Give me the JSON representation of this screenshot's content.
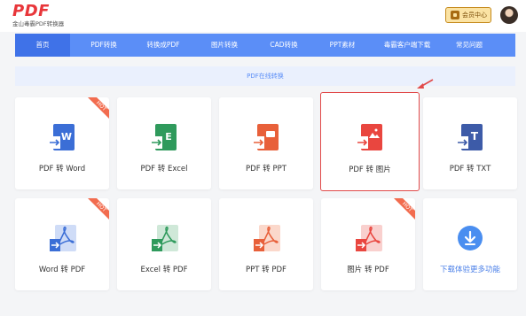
{
  "header": {
    "logo_text": "PDF",
    "logo_subtitle": "金山毒霸PDF转换器",
    "member_label": "会员中心"
  },
  "nav": {
    "items": [
      {
        "label": "首页",
        "active": true
      },
      {
        "label": "PDF转换",
        "active": false
      },
      {
        "label": "转换成PDF",
        "active": false
      },
      {
        "label": "图片转换",
        "active": false
      },
      {
        "label": "CAD转换",
        "active": false
      },
      {
        "label": "PPT素材",
        "active": false
      },
      {
        "label": "毒霸客户端下载",
        "active": false
      },
      {
        "label": "常见问题",
        "active": false
      }
    ]
  },
  "subbar": {
    "title": "PDF在线转换"
  },
  "tools": {
    "row1": [
      {
        "label": "PDF 转 Word",
        "badge": "HOT",
        "color": "#3b6ed6",
        "letter": "W"
      },
      {
        "label": "PDF 转 Excel",
        "badge": "",
        "color": "#2f9a5c",
        "letter": "E"
      },
      {
        "label": "PDF 转 PPT",
        "badge": "",
        "color": "#e8603a",
        "letter": "P"
      },
      {
        "label": "PDF 转 图片",
        "badge": "",
        "color": "#e9463f",
        "letter": "img"
      },
      {
        "label": "PDF 转 TXT",
        "badge": "",
        "color": "#3d5ba8",
        "letter": "T"
      }
    ],
    "row2": [
      {
        "label": "Word 转 PDF",
        "badge": "HOT",
        "color": "#3b6ed6"
      },
      {
        "label": "Excel 转 PDF",
        "badge": "",
        "color": "#2f9a5c"
      },
      {
        "label": "PPT 转 PDF",
        "badge": "",
        "color": "#e8603a"
      },
      {
        "label": "图片 转 PDF",
        "badge": "HOT",
        "color": "#e9463f"
      }
    ],
    "more_label": "下载体验更多功能"
  },
  "colors": {
    "accent": "#5b8ef7",
    "nav_active": "#3f72e8",
    "hot_ribbon": "#f26c4f",
    "highlight_border": "#e14a4a"
  }
}
